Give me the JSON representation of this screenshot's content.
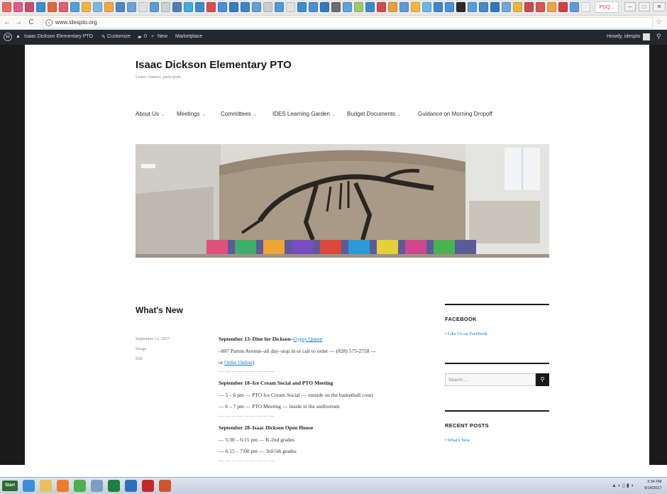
{
  "browser": {
    "tab_colors": [
      "#e86a5f",
      "#e05a8a",
      "#c84f6e",
      "#3a8ed6",
      "#e0663c",
      "#e45d6a",
      "#4aa3d9",
      "#f1b43c",
      "#7ab8e5",
      "#f0a93b",
      "#4d86c9",
      "#6aa2d6",
      "#e0e0e0",
      "#5b9bd5",
      "#d0d0d0",
      "#4c7ebd",
      "#45a8e0",
      "#3b8ec9",
      "#d94d4d",
      "#4a90d9",
      "#2f7fc1",
      "#3a86c8",
      "#5e9fd8",
      "#cccccc",
      "#4e9ad6",
      "#e0e0e0",
      "#3c8dd0",
      "#4d8fcf",
      "#2e7bbf",
      "#6c6c6c",
      "#5ba4dc",
      "#9ec66d",
      "#3d8bcf",
      "#cc4e4e",
      "#e5a23a",
      "#5a9bd8",
      "#f0b840",
      "#6cb7e6",
      "#3f87cb",
      "#4a90d9",
      "#2a2a2a",
      "#52a0da",
      "#4488cc",
      "#2f78c0",
      "#6fa8dc",
      "#e6b83a",
      "#c94b4b",
      "#d85555",
      "#f2a33a",
      "#d04040",
      "#5c9ad6",
      "#f0f0f0"
    ],
    "overflow_tab": "PDQ...",
    "window_buttons": [
      "–",
      "□",
      "✕"
    ],
    "url": "www.idespto.org",
    "back": "←",
    "forward": "→",
    "reload": "C",
    "info": "i",
    "star": "☆"
  },
  "adminbar": {
    "site_name": "Isaac Dickson Elementary PTO",
    "customize": "Customize",
    "comments": "0",
    "new": "New",
    "marketplace": "Marketplace",
    "howdy": "Howdy, idespto"
  },
  "site": {
    "title": "Isaac Dickson Elementary PTO",
    "tagline": "Learn, connect, participate"
  },
  "nav": [
    {
      "label": "About Us",
      "dropdown": true
    },
    {
      "label": "Meetings",
      "dropdown": true
    },
    {
      "label": "Committees",
      "dropdown": true
    },
    {
      "label": "IDES Learning Garden",
      "dropdown": true
    },
    {
      "label": "Budget Documents",
      "dropdown": true
    },
    {
      "label": "Guidance on Morning Dropoff",
      "dropdown": false
    }
  ],
  "post": {
    "title": "What's New",
    "meta": {
      "date": "September 12, 2017",
      "format": "Image",
      "edit": "Edit"
    },
    "lines": {
      "l1_bold": "September 13–Dine for Dickson–",
      "l1_link": "Gypsy Queen",
      "l2": "–807 Patton Avenue–all day–stop in or call to order — (828) 575-2758 —",
      "l3_prefix": "or ",
      "l3_link": "Order Online",
      "l3_suffix": ")",
      "sep": "— — — — — — — — —",
      "l4_bold": "September 18–Ice Cream Social and PTO Meeting",
      "l5": "— 5 – 6 pm — PTO Ice Cream Social — outside on the basketball court",
      "l6": "— 6 – 7 pm — PTO Meeting — inside in the auditorium",
      "l7_bold": "September 28–Isaac Dickson Open House",
      "l8": "— 5:30 – 6:15 pm — K-2nd grades",
      "l9": "— 6:15 – 7:00 pm — 3rd-5th grades"
    }
  },
  "sidebar": {
    "facebook_title": "FACEBOOK",
    "facebook_link": "Like Us on Facebook",
    "search_placeholder": "Search …",
    "search_icon": "search-icon",
    "recent_title": "RECENT POSTS",
    "recent_link": "What's New"
  },
  "taskbar": {
    "start": "Start",
    "icons": [
      {
        "name": "ie-icon",
        "color": "#3a8fd8"
      },
      {
        "name": "folder-icon",
        "color": "#e8c15a"
      },
      {
        "name": "media-icon",
        "color": "#f07c2a"
      },
      {
        "name": "chrome-icon",
        "color": "#4caf50"
      },
      {
        "name": "network-icon",
        "color": "#7a9fc2"
      },
      {
        "name": "excel-icon",
        "color": "#1e7e45"
      },
      {
        "name": "outlook-icon",
        "color": "#2f6fc0"
      },
      {
        "name": "acrobat-icon",
        "color": "#c62828"
      },
      {
        "name": "powerpoint-icon",
        "color": "#d35230"
      }
    ],
    "tray": "▲ ◐ ▯ ▮ ◑",
    "time": "3:34 PM",
    "date": "9/14/2017"
  }
}
